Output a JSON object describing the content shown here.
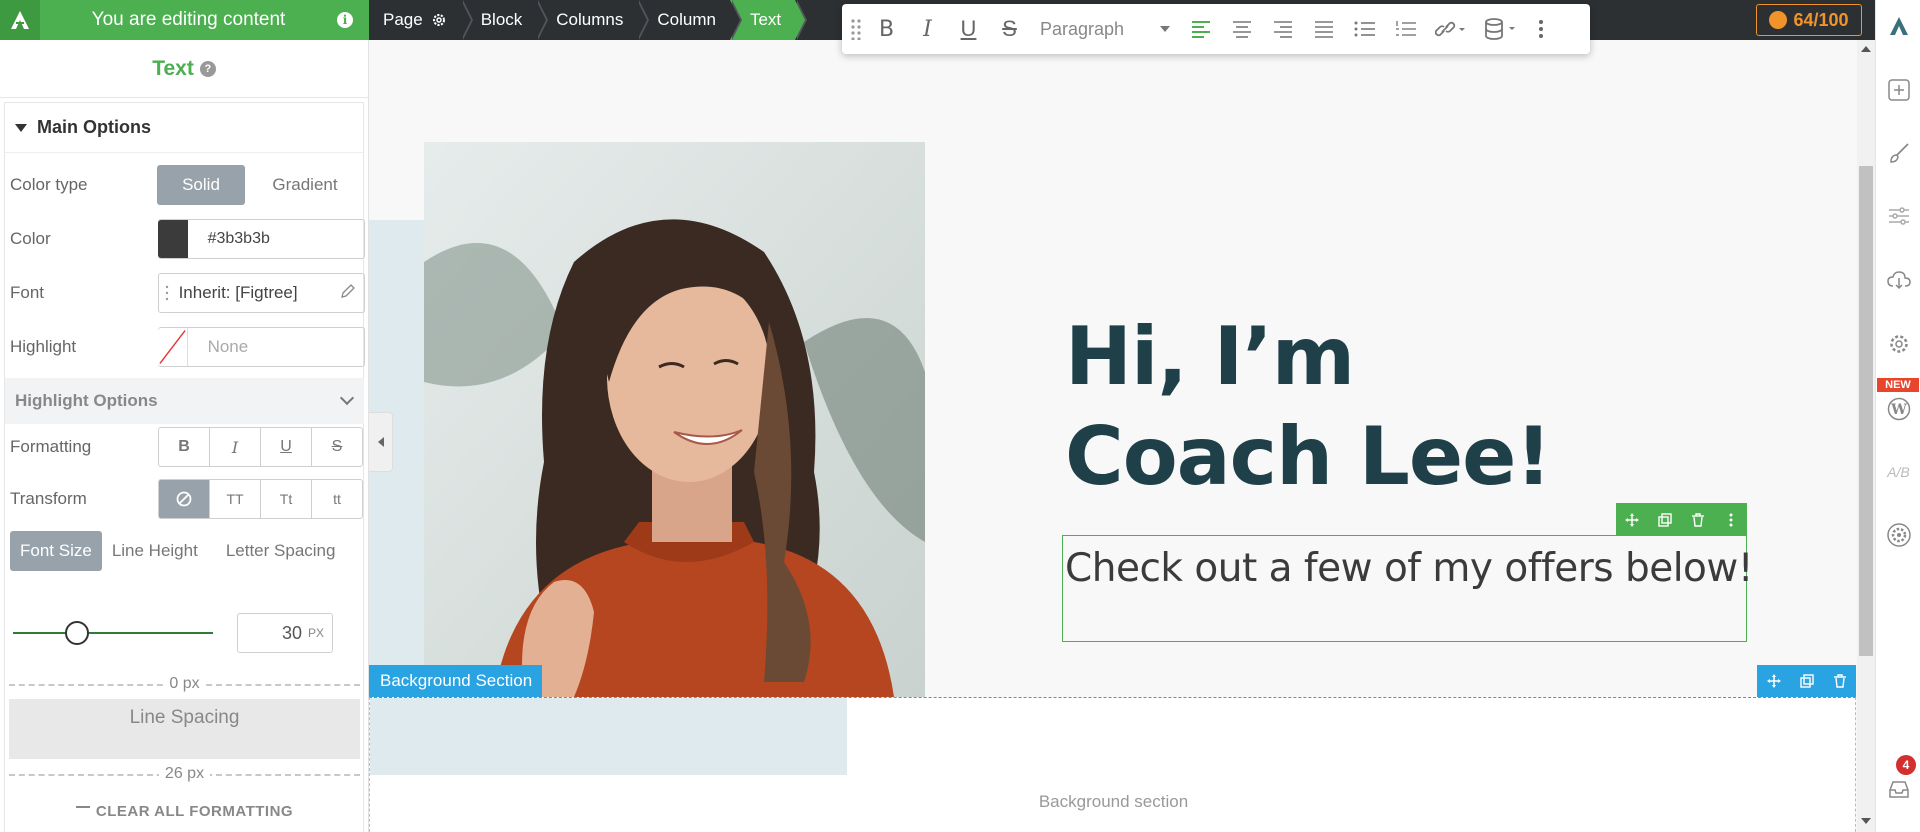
{
  "topbar": {
    "editing_title": "You are editing content",
    "breadcrumbs": [
      {
        "label": "Page"
      },
      {
        "label": "Block"
      },
      {
        "label": "Columns"
      },
      {
        "label": "Column"
      },
      {
        "label": "Text"
      }
    ],
    "score": "64/100",
    "score_color": "#f0932b"
  },
  "text_toolbar": {
    "buttons": [
      "bold-icon",
      "italic-icon",
      "underline-icon",
      "strikethrough-icon"
    ],
    "bold_glyph": "B",
    "italic_glyph": "I",
    "underline_glyph": "U",
    "strike_glyph": "S",
    "block_format": "Paragraph",
    "align_buttons": [
      "align-left-icon",
      "align-center-icon",
      "align-right-icon",
      "align-justify-icon"
    ],
    "list_buttons": [
      "bullet-list-icon",
      "numbered-list-icon"
    ],
    "extra_buttons": [
      "link-icon",
      "database-icon",
      "more-icon"
    ]
  },
  "panel": {
    "title": "Text",
    "help": "?",
    "main_options": "Main Options",
    "color_type": {
      "label": "Color type",
      "options": [
        "Solid",
        "Gradient"
      ],
      "selected": "Solid"
    },
    "color": {
      "label": "Color",
      "value": "#3b3b3b"
    },
    "font": {
      "label": "Font",
      "value": "Inherit: [Figtree]"
    },
    "highlight": {
      "label": "Highlight",
      "value": "None"
    },
    "highlight_options": "Highlight Options",
    "formatting": {
      "label": "Formatting",
      "buttons": [
        "B",
        "I",
        "U",
        "S"
      ]
    },
    "transform": {
      "label": "Transform",
      "buttons": [
        "TT",
        "Tt",
        "tt"
      ]
    },
    "size_tabs": [
      "Font Size",
      "Line Height",
      "Letter Spacing"
    ],
    "font_size": {
      "value": "30",
      "unit": "PX"
    },
    "spacing_top": "0 px",
    "line_spacing": "Line Spacing",
    "spacing_bottom": "26 px",
    "clear_formatting": "CLEAR ALL FORMATTING"
  },
  "canvas": {
    "heading": "Hi, I’m Coach Lee!",
    "text": "Check out a few of my offers below!",
    "bg_section_label": "Background Section",
    "bg_section_text": "Background section"
  },
  "sidebar": {
    "icons": [
      "add-icon",
      "brush-icon",
      "sliders-icon",
      "cloud-download-icon",
      "settings-icon",
      "wordpress-icon",
      "ab-test-icon",
      "settings-cog-icon"
    ],
    "new_badge": "NEW",
    "ab_label": "A/B",
    "notifications": "4"
  },
  "colors": {
    "accent_green": "#4caf50",
    "dark_bar": "#2d3033",
    "heading_color": "#1f4049",
    "section_blue": "#29a3e1"
  }
}
